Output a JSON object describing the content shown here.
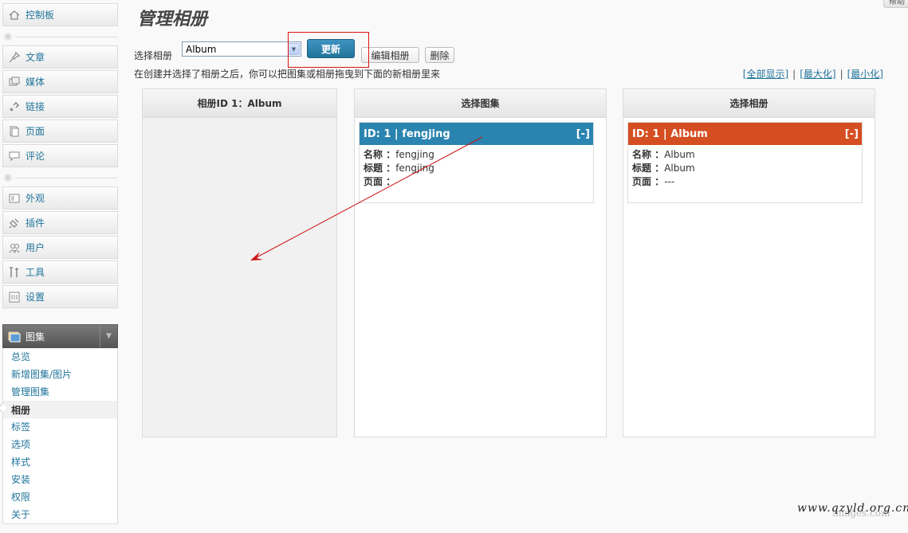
{
  "sidebar": {
    "dashboard": "控制板",
    "items_group1": [
      "文章",
      "媒体",
      "链接",
      "页面",
      "评论"
    ],
    "items_group2": [
      "外观",
      "插件",
      "用户",
      "工具",
      "设置"
    ],
    "gallery": {
      "label": "图集",
      "sub_items": [
        "总览",
        "新增图集/图片",
        "管理图集",
        "相册",
        "标签",
        "选项",
        "样式",
        "安装",
        "权限",
        "关于"
      ],
      "current": "相册"
    }
  },
  "header": {
    "title": "管理相册",
    "top_right_button": "帮助"
  },
  "toolbar": {
    "select_label": "选择相册",
    "select_value": "Album",
    "update_label": "更新",
    "edit_label": "编辑相册",
    "delete_label": "删除"
  },
  "instruction": "在创建并选择了相册之后，你可以把图集或相册拖曳到下面的新相册里来",
  "view_links": {
    "show_all": "[全部显示]",
    "maximize": "[最大化]",
    "minimize": "[最小化]",
    "separator": "|"
  },
  "columns": {
    "current_album": {
      "title": "相册ID 1：Album"
    },
    "select_gallery": {
      "title": "选择图集",
      "card": {
        "header": "ID: 1 | fengjing",
        "toggle": "[-]",
        "name_label": "名称 ：",
        "name_value": "fengjing",
        "title_label": "标题 ：",
        "title_value": "fengjing",
        "page_label": "页面 ：",
        "page_value": ""
      }
    },
    "select_album": {
      "title": "选择相册",
      "card": {
        "header": "ID: 1 | Album",
        "toggle": "[-]",
        "name_label": "名称 ：",
        "name_value": "Album",
        "title_label": "标题 ：",
        "title_value": "Album",
        "page_label": "页面 ：",
        "page_value": "---"
      }
    }
  },
  "watermark": "www.qzyld.org.cn",
  "colors": {
    "link": "#21759b",
    "gallery_card": "#2b84b0",
    "album_card": "#d54e21",
    "annotation": "#cc0000"
  }
}
